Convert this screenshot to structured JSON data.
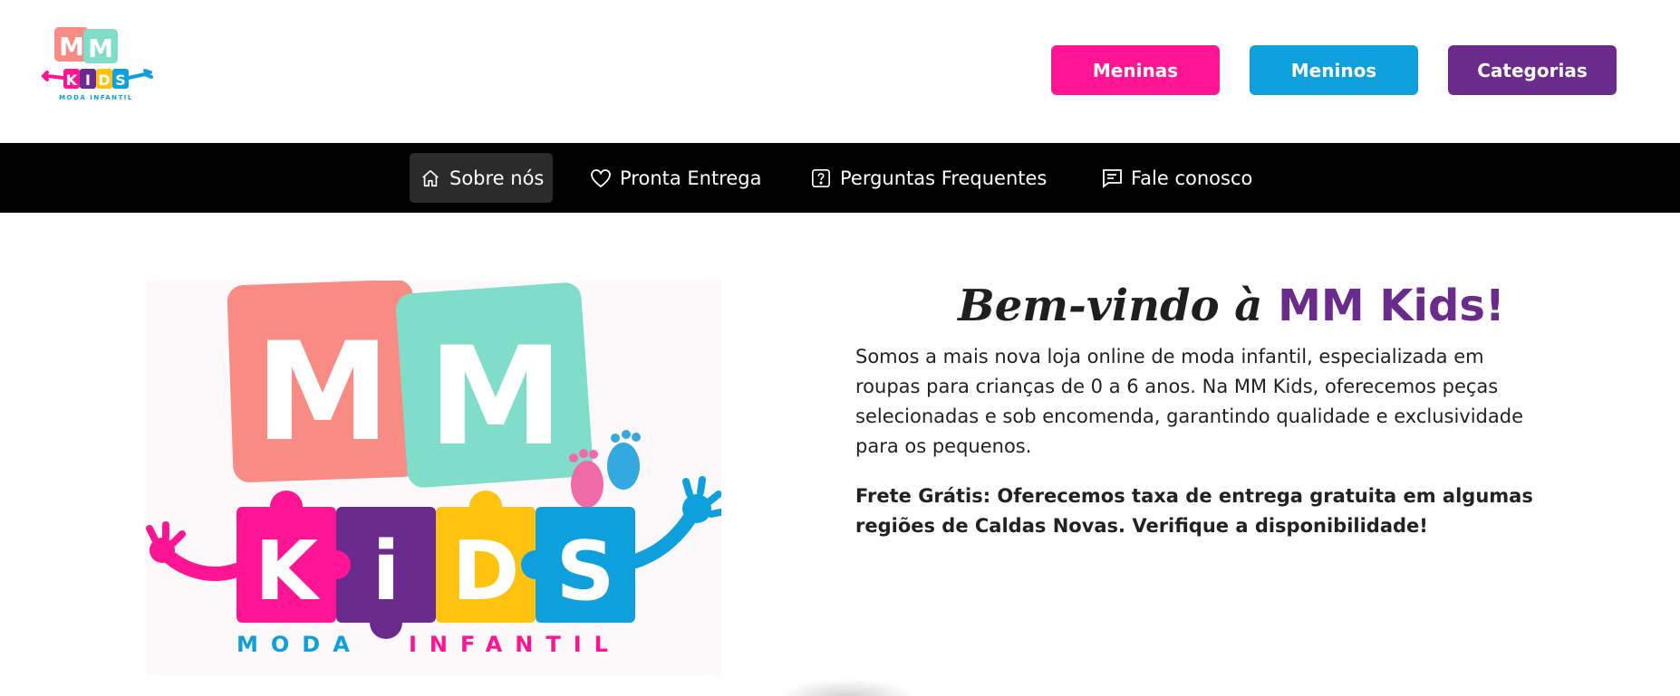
{
  "header": {
    "logo_alt": "MM Kids Moda Infantil",
    "logo_text_top": "MM",
    "logo_text_mid": "KIDS",
    "logo_text_bottom": "MODA INFANTIL",
    "buttons": [
      {
        "label": "Meninas",
        "color": "#ff1493"
      },
      {
        "label": "Meninos",
        "color": "#0ea0dd"
      },
      {
        "label": "Categorias",
        "color": "#6a2b8c"
      }
    ]
  },
  "nav": {
    "items": [
      {
        "label": "Sobre nós",
        "icon": "home-icon",
        "active": true
      },
      {
        "label": "Pronta Entrega",
        "icon": "heart-icon",
        "active": false
      },
      {
        "label": "Perguntas Frequentes",
        "icon": "question-icon",
        "active": false
      },
      {
        "label": "Fale conosco",
        "icon": "message-icon",
        "active": false
      }
    ]
  },
  "main": {
    "welcome_script": "Bem-vindo à",
    "welcome_brand": "MM Kids!",
    "intro": "Somos a mais nova loja online de moda infantil, especializada em roupas para crianças de 0 a 6 anos. Na MM Kids, oferecemos peças selecionadas e sob encomenda, garantindo qualidade e exclusividade para os pequenos.",
    "shipping": "Frete Grátis: Oferecemos taxa de entrega gratuita em algumas regiões de Caldas Novas. Verifique a disponibilidade!",
    "hero_logo": {
      "top": "MM",
      "mid": [
        "K",
        "i",
        "D",
        "S"
      ],
      "bottom": "MODA INFANTIL"
    }
  },
  "colors": {
    "pink": "#ff1493",
    "blue": "#0ea0dd",
    "purple": "#6a2b8c",
    "yellow": "#ffc20e",
    "salmon": "#f98b85",
    "mint": "#7fddc9"
  }
}
